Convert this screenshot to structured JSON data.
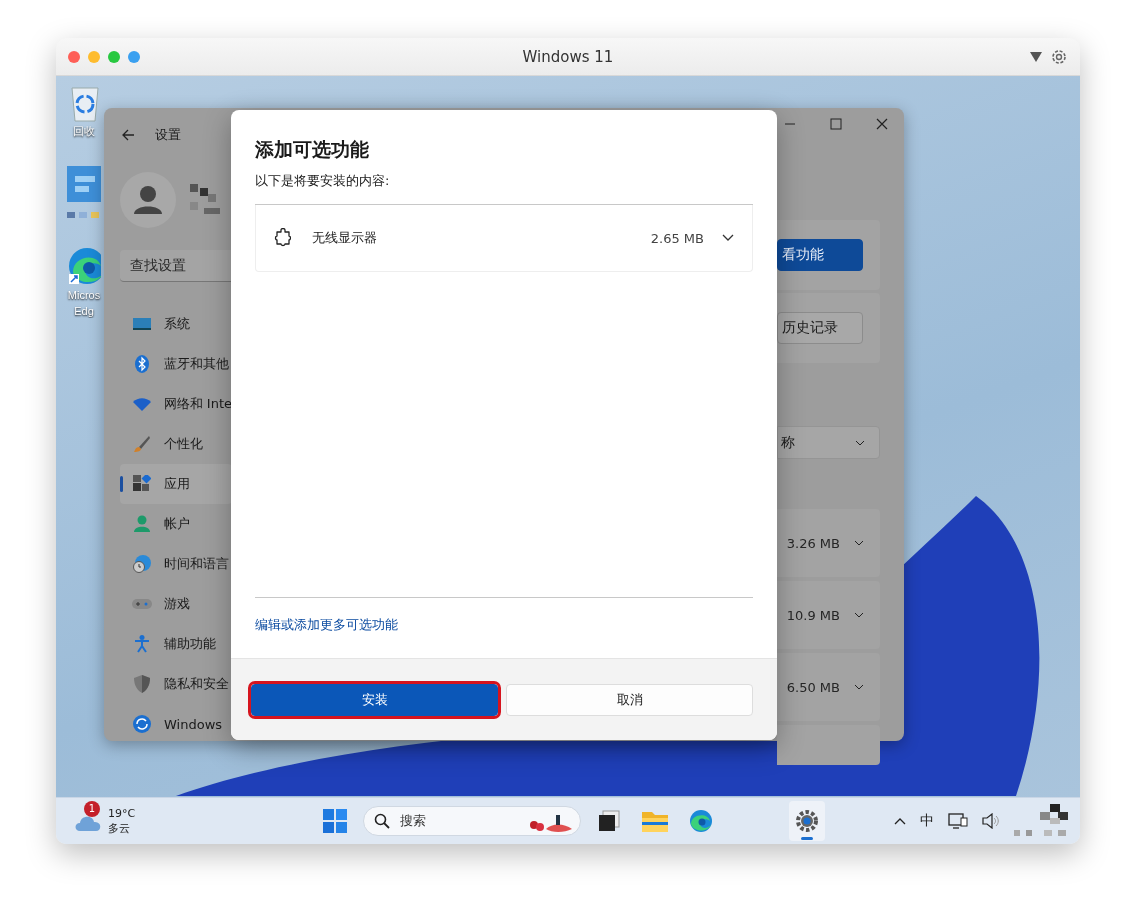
{
  "mac_window": {
    "title": "Windows 11"
  },
  "desktop_icons": [
    {
      "kind": "recycle",
      "lines": [
        "回收"
      ]
    },
    {
      "kind": "app"
    },
    {
      "kind": "edge",
      "lines": [
        "Micros",
        "Edg"
      ]
    }
  ],
  "settings": {
    "title": "设置",
    "search": {
      "placeholder": "查找设置"
    },
    "nav": [
      {
        "kind": "system",
        "label": "系统",
        "selected": false
      },
      {
        "kind": "bluetooth",
        "label": "蓝牙和其他",
        "selected": false
      },
      {
        "kind": "network",
        "label": "网络和 Inte",
        "selected": false
      },
      {
        "kind": "personalize",
        "label": "个性化",
        "selected": false
      },
      {
        "kind": "apps",
        "label": "应用",
        "selected": true
      },
      {
        "kind": "account",
        "label": "帐户",
        "selected": false
      },
      {
        "kind": "time",
        "label": "时间和语言",
        "selected": false
      },
      {
        "kind": "gaming",
        "label": "游戏",
        "selected": false
      },
      {
        "kind": "accessibility",
        "label": "辅助功能",
        "selected": false
      },
      {
        "kind": "privacy",
        "label": "隐私和安全",
        "selected": false
      },
      {
        "kind": "update",
        "label": "Windows",
        "selected": false
      }
    ],
    "buttons": [
      {
        "label": "看功能",
        "kind": "primary"
      },
      {
        "label": "历史记录",
        "kind": "secondary"
      }
    ],
    "sort_dropdown": {
      "value": "称"
    },
    "feature_sizes": [
      "3.26 MB",
      "10.9 MB",
      "6.50 MB"
    ]
  },
  "dialog": {
    "title": "添加可选功能",
    "subtitle": "以下是将要安装的内容:",
    "features": [
      {
        "name": "无线显示器",
        "size": "2.65 MB"
      }
    ],
    "link": "编辑或添加更多可选功能",
    "buttons": [
      {
        "label": "安装",
        "kind": "primary",
        "highlighted": true
      },
      {
        "label": "取消",
        "kind": "secondary",
        "highlighted": false
      }
    ]
  },
  "taskbar": {
    "weather": {
      "badge": "1",
      "temperature": "19°C",
      "condition": "多云"
    },
    "search": {
      "placeholder": "搜索"
    },
    "apps": [
      {
        "kind": "start",
        "active": false
      },
      {
        "kind": "taskview",
        "active": false
      },
      {
        "kind": "explorer",
        "active": false
      },
      {
        "kind": "edge",
        "active": false
      },
      {
        "kind": "settings",
        "active": true
      }
    ],
    "tray": {
      "ime": "中"
    }
  }
}
